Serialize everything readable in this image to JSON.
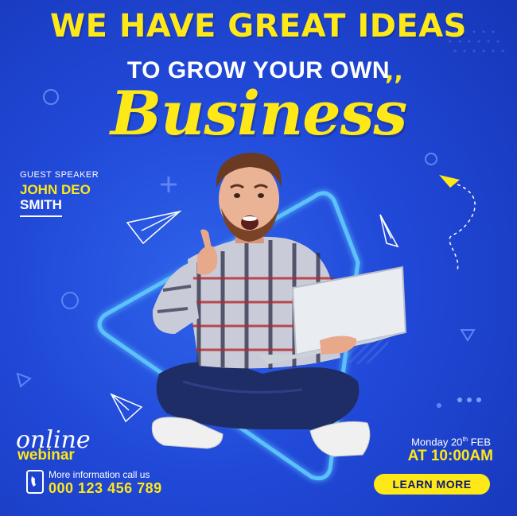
{
  "headline": {
    "line1": "WE HAVE GREAT IDEAS",
    "line2": "TO GROW YOUR OWN",
    "script_word": "Business"
  },
  "speaker": {
    "label": "GUEST SPEAKER",
    "name_first": "JOHN DEO",
    "name_last": "SMITH"
  },
  "event": {
    "online": "online",
    "webinar": "webinar",
    "info_label": "More information call us",
    "phone": "000 123 456 789",
    "date": "Monday 20th FEB",
    "time": "AT 10:00AM",
    "cta": "LEARN MORE"
  },
  "colors": {
    "background": "#2149d8",
    "accent": "#ffe817",
    "neon": "#7fd6ff"
  },
  "icons": [
    "paper-plane-icon",
    "phone-icon",
    "plus-icon",
    "circle-icon",
    "triangle-icon",
    "dots-icon",
    "quote-icon"
  ]
}
